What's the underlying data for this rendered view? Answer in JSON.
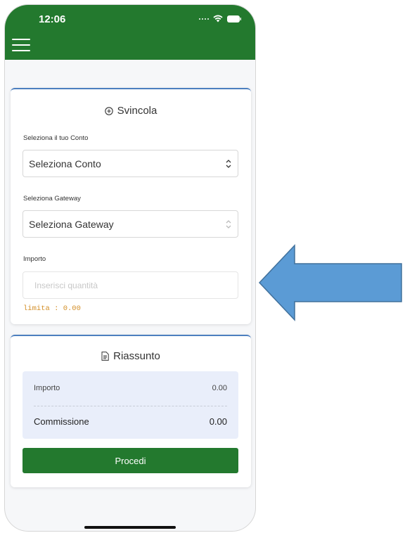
{
  "status_bar": {
    "time": "12:06"
  },
  "withdraw": {
    "title": "Svincola",
    "account_label": "Seleziona il tuo Conto",
    "account_value": "Seleziona Conto",
    "gateway_label": "Seleziona Gateway",
    "gateway_value": "Seleziona Gateway",
    "amount_label": "Importo",
    "amount_placeholder": "Inserisci quantità",
    "limit_text": "limita : 0.00"
  },
  "summary": {
    "title": "Riassunto",
    "amount_label": "Importo",
    "amount_value": "0.00",
    "fee_label": "Commissione",
    "fee_value": "0.00",
    "proceed_label": "Procedi"
  },
  "colors": {
    "brand": "#23792e",
    "accent": "#4c7fbf",
    "arrow": "#5b9bd5",
    "limit": "#d4902a"
  }
}
